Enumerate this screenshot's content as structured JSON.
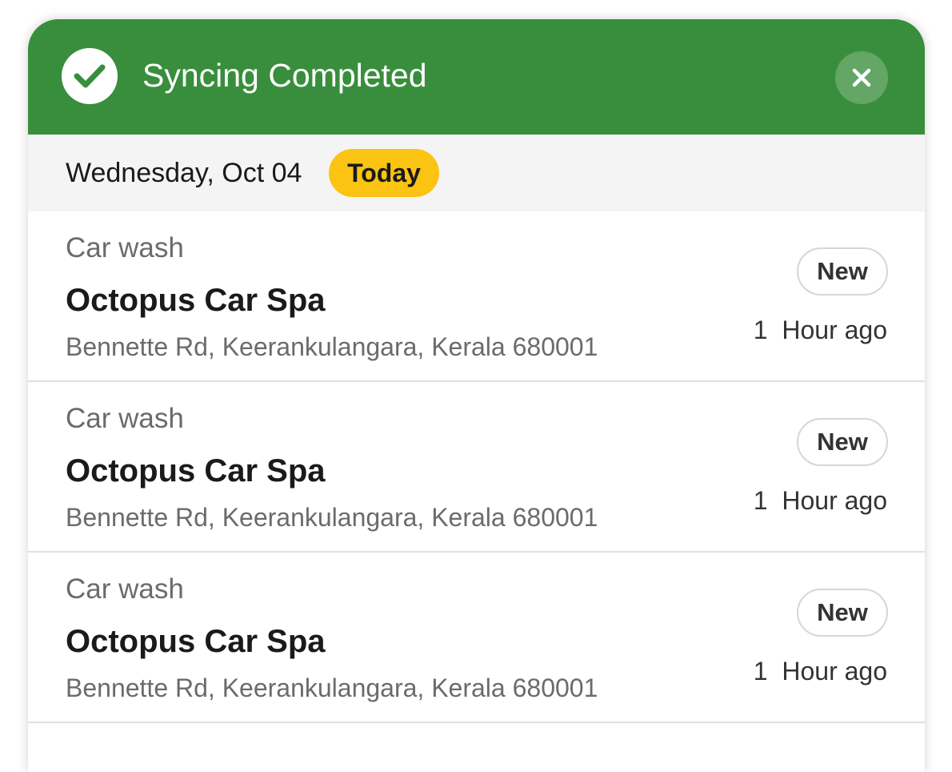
{
  "banner": {
    "title": "Syncing Completed",
    "icon": "check-circle-icon",
    "close_icon": "close-icon",
    "background_color": "#388e3c"
  },
  "date_header": {
    "date": "Wednesday, Oct 04",
    "badge": "Today",
    "badge_color": "#fbc312"
  },
  "items": [
    {
      "category": "Car wash",
      "name": "Octopus Car Spa",
      "address": "Bennette Rd, Keerankulangara, Kerala 680001",
      "status": "New",
      "time": "1  Hour ago"
    },
    {
      "category": "Car wash",
      "name": "Octopus Car Spa",
      "address": "Bennette Rd, Keerankulangara, Kerala 680001",
      "status": "New",
      "time": "1  Hour ago"
    },
    {
      "category": "Car wash",
      "name": "Octopus Car Spa",
      "address": "Bennette Rd, Keerankulangara, Kerala 680001",
      "status": "New",
      "time": "1  Hour ago"
    }
  ]
}
